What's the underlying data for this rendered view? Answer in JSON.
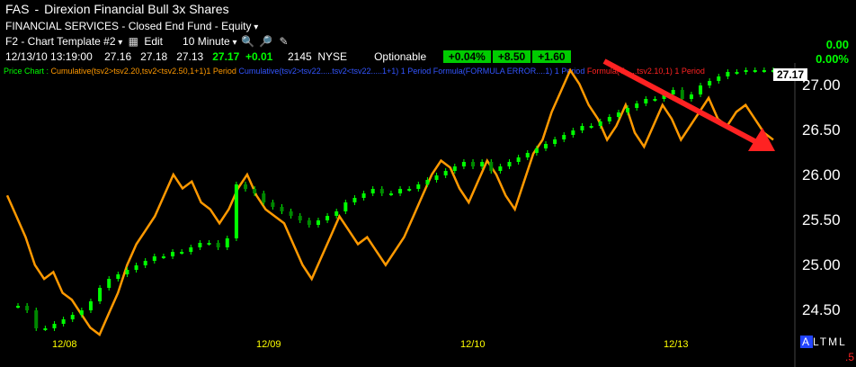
{
  "header": {
    "symbol": "FAS",
    "separator": "-",
    "name": "Direxion Financial Bull 3x Shares",
    "classification": "FINANCIAL SERVICES - Closed End Fund - Equity"
  },
  "toolbar": {
    "template": "F2 - Chart Template #2",
    "edit_label": "Edit",
    "interval": "10 Minute"
  },
  "quote": {
    "datetime": "12/13/10 13:19:00",
    "open": "27.16",
    "high": "27.18",
    "low": "27.13",
    "last": "27.17",
    "change": "+0.01",
    "volume": "2145",
    "exchange": "NYSE",
    "optionable": "Optionable",
    "box1": "+0.04%",
    "box2": "+8.50",
    "box3": "+1.60",
    "day_change": "0.00",
    "day_change_pct": "0.00%"
  },
  "studies": {
    "price_chart": "Price Chart :",
    "study1": "Cumulative(tsv2>tsv2.20,tsv2<tsv2.50,1+1)1 Period",
    "study2": "Cumulative(tsv2>tsv22.....tsv2<tsv22.....1+1) 1 Period",
    "study3": "Formula(FORMULA ERROR....1) 1 Period",
    "study4": "Formula(T......tsv2.10,1) 1 Period"
  },
  "axis": {
    "y_labels": [
      "27.00",
      "26.50",
      "26.00",
      "25.50",
      "25.00",
      "24.50"
    ],
    "x_labels": [
      "12/08",
      "12/09",
      "12/10",
      "12/13"
    ],
    "last_price_tag": "27.17",
    "modes": "LTML",
    "mode_active": "A",
    "bottom_value": ".5"
  },
  "colors": {
    "price_up": "#00ff00",
    "indicator": "#ff9900",
    "arrow": "#ff2222",
    "axis_label": "#ffff00"
  },
  "chart_data": {
    "type": "line",
    "ylim": [
      24.2,
      27.25
    ],
    "x_labels": [
      "12/08",
      "12/09",
      "12/10",
      "12/13"
    ],
    "series": [
      {
        "kind": "price",
        "values": [
          24.55,
          24.5,
          24.3,
          24.3,
          24.35,
          24.4,
          24.45,
          24.5,
          24.6,
          24.75,
          24.85,
          24.9,
          24.95,
          25.0,
          25.05,
          25.1,
          25.1,
          25.15,
          25.15,
          25.2,
          25.25,
          25.25,
          25.2,
          25.3,
          25.9,
          25.85,
          25.8,
          25.7,
          25.65,
          25.6,
          25.55,
          25.5,
          25.45,
          25.5,
          25.55,
          25.6,
          25.7,
          25.75,
          25.8,
          25.85,
          25.8,
          25.8,
          25.85,
          25.85,
          25.9,
          25.95,
          26.0,
          26.05,
          26.1,
          26.15,
          26.1,
          26.15,
          26.05,
          26.1,
          26.15,
          26.2,
          26.25,
          26.3,
          26.35,
          26.4,
          26.45,
          26.5,
          26.55,
          26.55,
          26.6,
          26.65,
          26.7,
          26.75,
          26.8,
          26.85,
          26.85,
          26.9,
          26.95,
          26.85,
          26.9,
          27.0,
          27.05,
          27.1,
          27.15,
          27.15,
          27.17,
          27.17,
          27.17,
          27.17
        ]
      },
      {
        "kind": "indicator",
        "values": [
          20,
          17,
          14,
          10,
          8,
          9,
          6,
          5,
          3,
          1,
          0,
          3,
          6,
          10,
          13,
          15,
          17,
          20,
          23,
          21,
          22,
          19,
          18,
          16,
          18,
          21,
          23,
          20,
          18,
          17,
          16,
          13,
          10,
          8,
          11,
          14,
          17,
          15,
          13,
          14,
          12,
          10,
          12,
          14,
          17,
          20,
          23,
          25,
          24,
          21,
          19,
          22,
          25,
          23,
          20,
          18,
          22,
          26,
          28,
          32,
          35,
          38,
          36,
          33,
          31,
          28,
          30,
          33,
          29,
          27,
          30,
          33,
          31,
          28,
          30,
          32,
          34,
          31,
          30,
          32,
          33,
          31,
          29,
          28
        ]
      }
    ],
    "annotations": [
      "downward red arrow over the last day"
    ]
  }
}
